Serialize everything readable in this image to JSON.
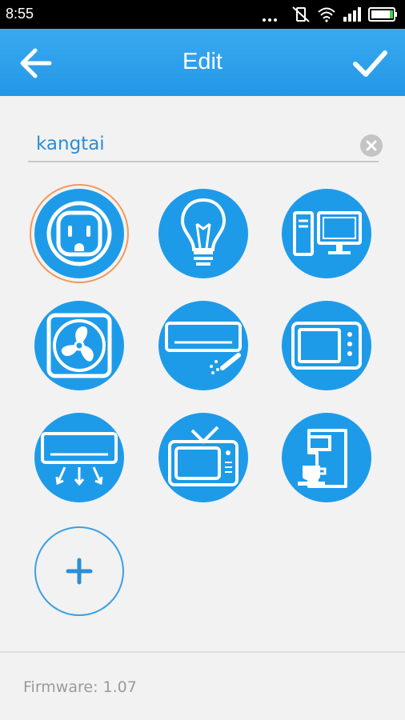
{
  "status_bar": {
    "time": "8:55"
  },
  "app_bar": {
    "title": "Edit"
  },
  "name_field": {
    "value": "kangtai"
  },
  "device_icons": [
    {
      "name": "outlet-icon",
      "selected": true
    },
    {
      "name": "light-bulb-icon",
      "selected": false
    },
    {
      "name": "computer-icon",
      "selected": false
    },
    {
      "name": "fan-icon",
      "selected": false
    },
    {
      "name": "air-conditioner-icon",
      "selected": false
    },
    {
      "name": "microwave-icon",
      "selected": false
    },
    {
      "name": "air-conditioner-airflow-icon",
      "selected": false
    },
    {
      "name": "tv-icon",
      "selected": false
    },
    {
      "name": "coffee-maker-icon",
      "selected": false
    }
  ],
  "footer": {
    "firmware": "Firmware: 1.07"
  },
  "colors": {
    "app_bar": "#2b9ff0",
    "icon_bg": "#1e9be8",
    "selected_ring": "#f19a5b",
    "text_accent": "#2b8fd6"
  }
}
